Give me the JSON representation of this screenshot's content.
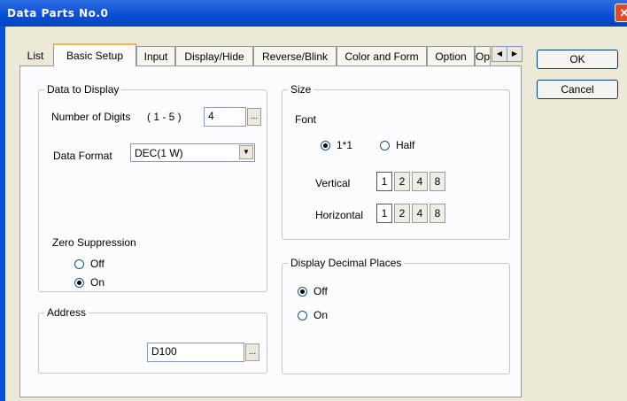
{
  "window": {
    "title": "Data Parts No.0",
    "close": "✕"
  },
  "tabs": [
    "List",
    "Basic Setup",
    "Input",
    "Display/Hide",
    "Reverse/Blink",
    "Color and Form",
    "Option",
    "Op"
  ],
  "tab_scroll": {
    "left": "◀",
    "right": "▶"
  },
  "buttons": {
    "ok": "OK",
    "cancel": "Cancel"
  },
  "data_to_display": {
    "title": "Data to Display",
    "digits_label": "Number of Digits",
    "digits_range": "( 1 - 5 )",
    "digits_value": "4",
    "ellipsis": "...",
    "format_label": "Data Format",
    "format_value": "DEC(1 W)",
    "zero_suppression": {
      "label": "Zero Suppression",
      "options": [
        "Off",
        "On"
      ],
      "selected": "On"
    }
  },
  "address": {
    "title": "Address",
    "value": "D100",
    "ellipsis": "..."
  },
  "size": {
    "title": "Size",
    "font_label": "Font",
    "font_options": [
      "1*1",
      "Half"
    ],
    "font_selected": "1*1",
    "vertical_label": "Vertical",
    "horizontal_label": "Horizontal",
    "multipliers": [
      "1",
      "2",
      "4",
      "8"
    ],
    "vertical_selected": "1",
    "horizontal_selected": "1"
  },
  "decimal_places": {
    "title": "Display Decimal Places",
    "options": [
      "Off",
      "On"
    ],
    "selected": "Off"
  },
  "icons": {
    "dropdown": "chevron-down-icon",
    "close": "close-icon"
  }
}
